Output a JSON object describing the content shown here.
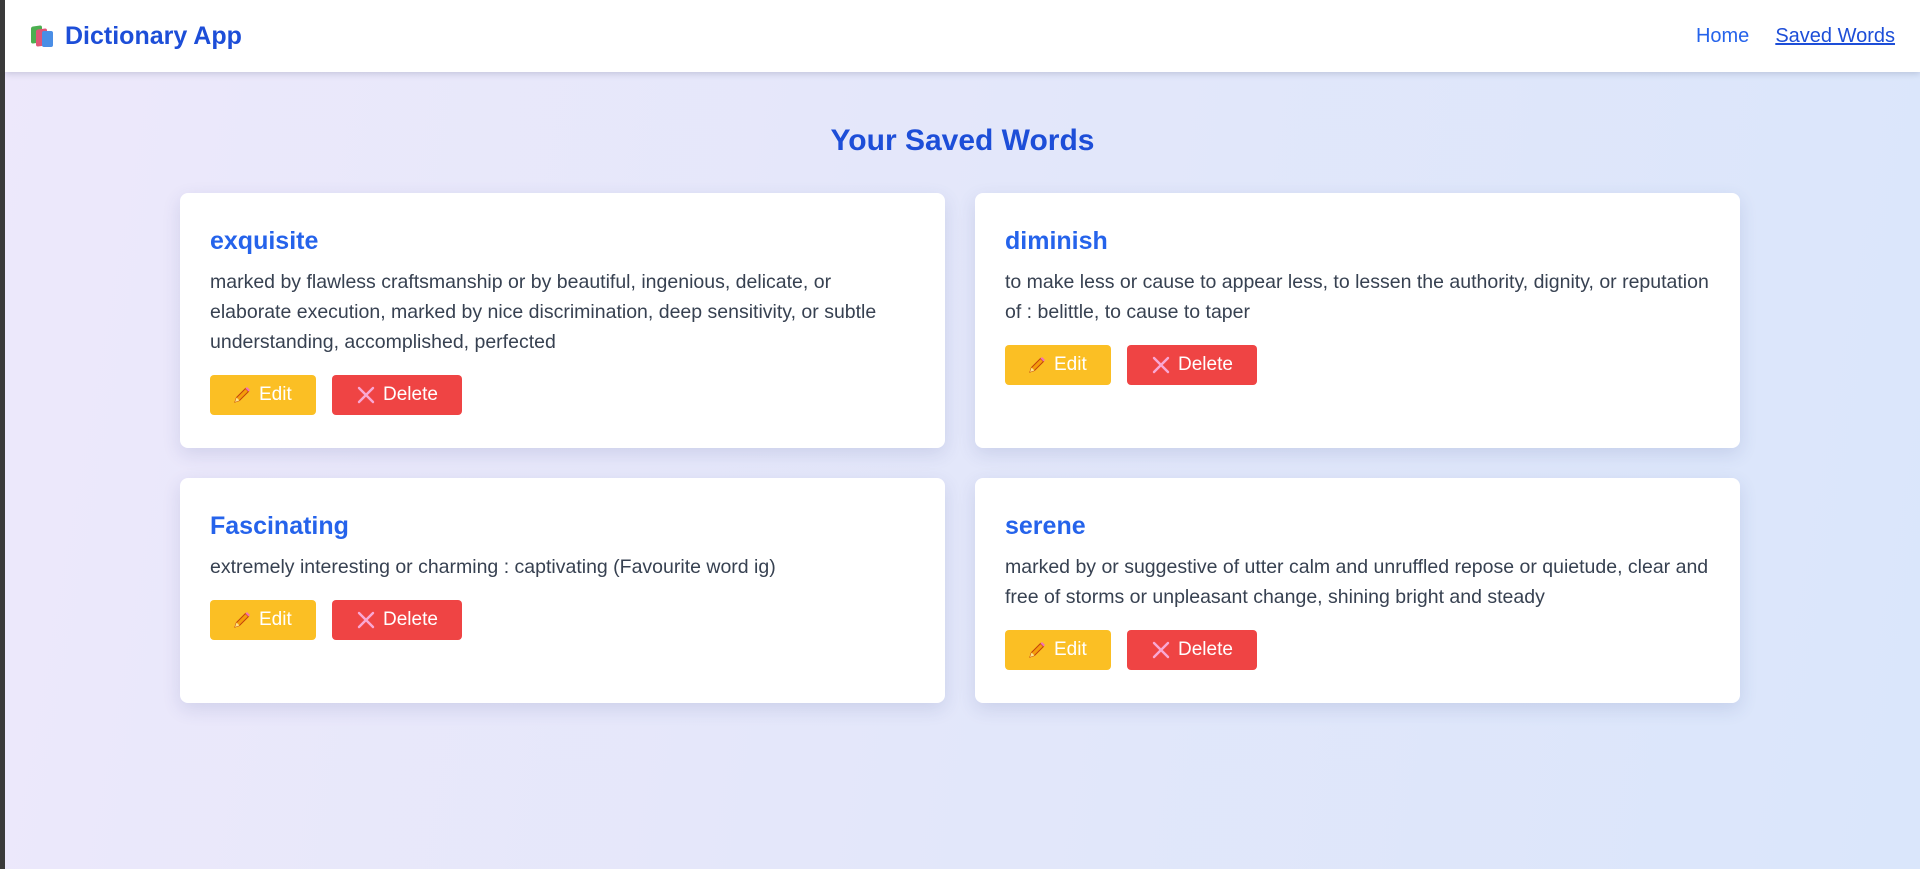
{
  "navbar": {
    "brand_label": "Dictionary App",
    "brand_icon": "books-icon",
    "links": [
      {
        "label": "Home",
        "active": false
      },
      {
        "label": "Saved Words",
        "active": true
      }
    ]
  },
  "main": {
    "title": "Your Saved Words"
  },
  "words": [
    {
      "word": "exquisite",
      "definition": "marked by flawless craftsmanship or by beautiful, ingenious, delicate, or elaborate execution, marked by nice discrimination, deep sensitivity, or subtle understanding, accomplished, perfected",
      "edit_label": "Edit",
      "delete_label": "Delete"
    },
    {
      "word": "diminish",
      "definition": "to make less or cause to appear less, to lessen the authority, dignity, or reputation of : belittle, to cause to taper",
      "edit_label": "Edit",
      "delete_label": "Delete"
    },
    {
      "word": "Fascinating",
      "definition": "extremely interesting or charming : captivating (Favourite word ig)",
      "edit_label": "Edit",
      "delete_label": "Delete"
    },
    {
      "word": "serene",
      "definition": "marked by or suggestive of utter calm and unruffled repose or quietude, clear and free of storms or unpleasant change, shining bright and steady",
      "edit_label": "Edit",
      "delete_label": "Delete"
    }
  ],
  "colors": {
    "brand": "#1d4ed8",
    "word": "#2563eb",
    "edit_button": "#fbbf24",
    "delete_button": "#ef4444"
  }
}
